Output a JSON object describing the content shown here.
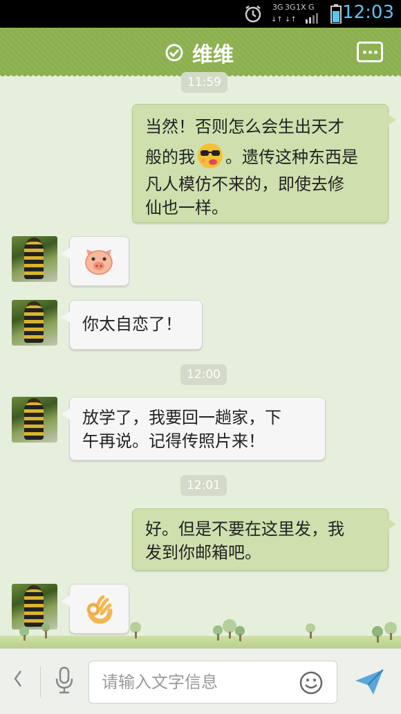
{
  "status_bar": {
    "time": "12:03",
    "network_text_1": "3G",
    "network_text_2": "3G",
    "network_text_3": "1X",
    "network_text_4": "G",
    "icons": [
      "alarm-icon",
      "signal-icon",
      "battery-icon"
    ]
  },
  "header": {
    "contact_name": "维维",
    "icons": [
      "verified-check-icon",
      "more-options-icon"
    ]
  },
  "messages": [
    {
      "type": "time",
      "text": "11:59"
    },
    {
      "type": "sent",
      "lines": [
        "当然！否则怎么会生出天才",
        "般的我",
        "。遗传这种东西是",
        "凡人模仿不来的，即使去修",
        "仙也一样。"
      ],
      "emoji": "cool-face-emoji"
    },
    {
      "type": "received",
      "emoji": "pig-face-emoji"
    },
    {
      "type": "received",
      "text": "你太自恋了！"
    },
    {
      "type": "time",
      "text": "12:00"
    },
    {
      "type": "received",
      "lines": [
        "放学了，我要回一趟家，下",
        "午再说。记得传照片来！"
      ]
    },
    {
      "type": "time",
      "text": "12:01"
    },
    {
      "type": "sent",
      "lines": [
        "好。但是不要在这里发，我",
        "发到你邮箱吧。"
      ]
    },
    {
      "type": "received",
      "emoji": "ok-hand-emoji"
    }
  ],
  "input_bar": {
    "placeholder": "请输入文字信息",
    "icons": [
      "back-icon",
      "microphone-icon",
      "smiley-icon",
      "send-icon"
    ]
  },
  "colors": {
    "header": "#8cb04f",
    "sent_bubble": "#cfe0ae",
    "received_bubble": "#f6f6f6",
    "chat_background": "#e6efdc",
    "clock": "#5fc3f0"
  }
}
